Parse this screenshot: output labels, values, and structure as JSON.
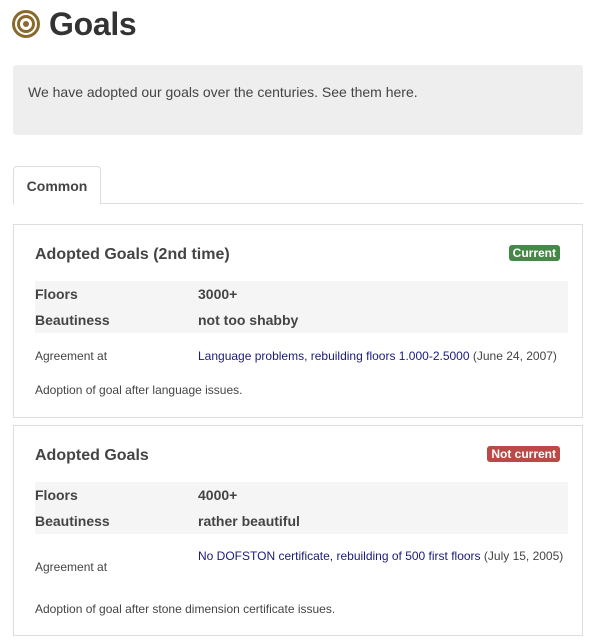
{
  "page": {
    "title": "Goals",
    "icon": "target-icon",
    "intro": "We have adopted our goals over the centuries. See them here."
  },
  "tabs": [
    {
      "label": "Common",
      "active": true
    }
  ],
  "goals": [
    {
      "title": "Adopted Goals (2nd time)",
      "badge": "Current",
      "badge_color": "#468847",
      "specs": [
        {
          "key": "Floors",
          "value": "3000+"
        },
        {
          "key": "Beautiness",
          "value": "not too shabby"
        }
      ],
      "agreement_label": "Agreement at",
      "agreement_link": "Language problems, rebuilding floors 1.000-2.5000",
      "agreement_date": " (June 24, 2007)",
      "note": "Adoption of goal after language issues."
    },
    {
      "title": "Adopted Goals",
      "badge": "Not current",
      "badge_color": "#b94a48",
      "specs": [
        {
          "key": "Floors",
          "value": "4000+"
        },
        {
          "key": "Beautiness",
          "value": "rather beautiful"
        }
      ],
      "agreement_label": "Agreement at",
      "agreement_link": "No DOFSTON certificate, rebuilding of 500 first floors",
      "agreement_date": " (July 15, 2005)",
      "note": "Adoption of goal after stone dimension certificate issues."
    }
  ],
  "colors": {
    "accent_icon": "#8a6a2c",
    "link": "#1a1a7a"
  }
}
